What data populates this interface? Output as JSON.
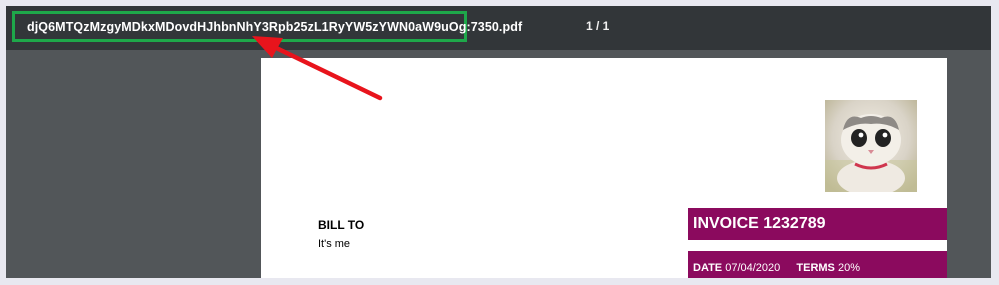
{
  "toolbar": {
    "filename": "djQ6MTQzMzgyMDkxMDovdHJhbnNhY3Rpb25zL1RyYW5zYWN0aW9uOg:7350.pdf",
    "page_counter": "1 / 1"
  },
  "document": {
    "bill_to_label": "BILL TO",
    "bill_to_name": "It's me",
    "invoice_title": "INVOICE 1232789",
    "date_label": "DATE",
    "date_value": "07/04/2020",
    "terms_label": "TERMS",
    "terms_value": "20%"
  },
  "colors": {
    "highlight_box": "#1ea84a",
    "arrow": "#e8141c",
    "invoice_banner": "#8b0a5e",
    "toolbar_bg": "#323639",
    "viewer_bg": "#525659"
  },
  "icons": [
    "cat-photo",
    "red-arrow-annotation"
  ]
}
